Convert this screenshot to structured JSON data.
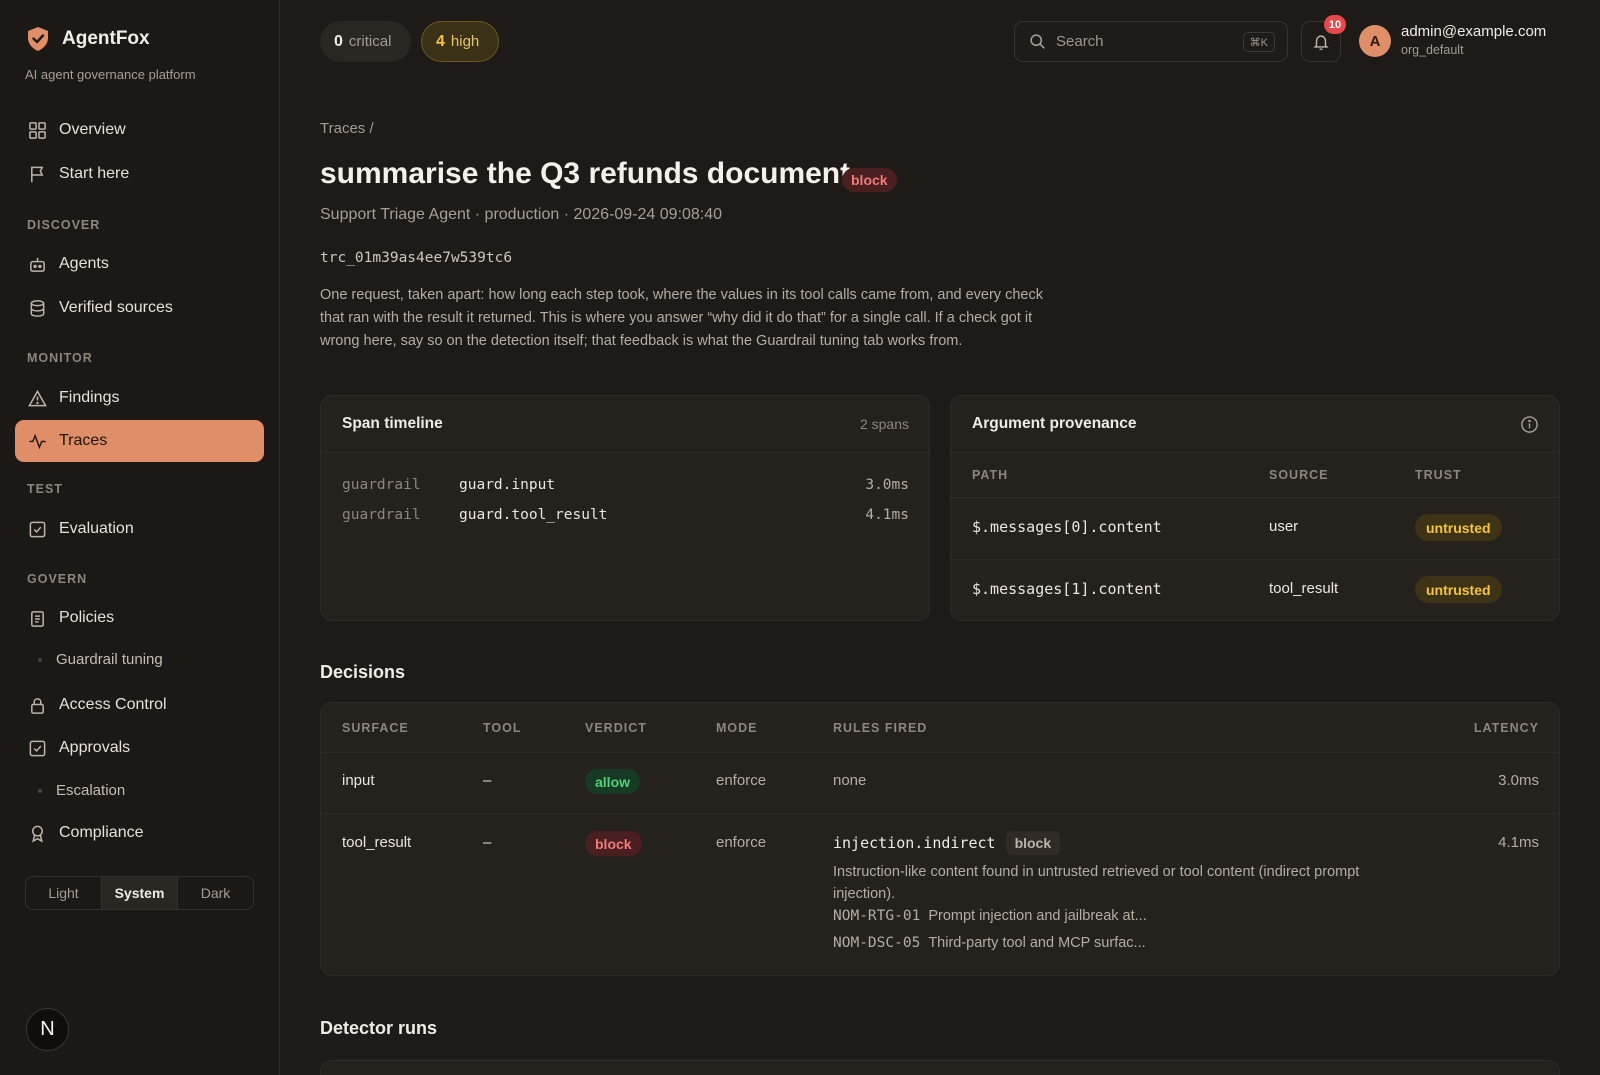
{
  "brand": {
    "name": "AgentFox",
    "tagline": "AI agent governance platform"
  },
  "nav": {
    "overview": "Overview",
    "start_here": "Start here",
    "discover_label": "DISCOVER",
    "agents": "Agents",
    "verified_sources": "Verified sources",
    "monitor_label": "MONITOR",
    "findings": "Findings",
    "traces": "Traces",
    "test_label": "TEST",
    "evaluation": "Evaluation",
    "govern_label": "GOVERN",
    "policies": "Policies",
    "guardrail_tuning": "Guardrail tuning",
    "access_control": "Access Control",
    "approvals": "Approvals",
    "escalation": "Escalation",
    "compliance": "Compliance"
  },
  "theme": {
    "light": "Light",
    "system": "System",
    "dark": "Dark",
    "selected": "System"
  },
  "footer_badge": "N",
  "header": {
    "critical_count": "0",
    "critical_label": "critical",
    "high_count": "4",
    "high_label": "high",
    "search_placeholder": "Search",
    "search_shortcut": "⌘K",
    "notifications": "10",
    "avatar_initial": "A",
    "user_email": "admin@example.com",
    "user_org": "org_default"
  },
  "trace": {
    "breadcrumb": "Traces  /",
    "title": "summarise the Q3 refunds document",
    "verdict": "block",
    "subline": "Support Triage Agent · production · 2026-09-24 09:08:40",
    "id": "trc_01m39as4ee7w539tc6",
    "description": "One request, taken apart: how long each step took, where the values in its tool calls came from, and every check that ran with the result it returned. This is where you answer “why did it do that” for a single call. If a check got it wrong here, say so on the detection itself; that feedback is what the Guardrail tuning tab works from."
  },
  "span_timeline": {
    "title": "Span timeline",
    "count": "2 spans",
    "spans": [
      {
        "kind": "guardrail",
        "name": "guard.input",
        "duration": "3.0ms"
      },
      {
        "kind": "guardrail",
        "name": "guard.tool_result",
        "duration": "4.1ms"
      }
    ]
  },
  "provenance": {
    "title": "Argument provenance",
    "headers": {
      "path": "PATH",
      "source": "SOURCE",
      "trust": "TRUST"
    },
    "rows": [
      {
        "path": "$.messages[0].content",
        "source": "user",
        "trust": "untrusted"
      },
      {
        "path": "$.messages[1].content",
        "source": "tool_result",
        "trust": "untrusted"
      }
    ]
  },
  "decisions": {
    "title": "Decisions",
    "headers": {
      "surface": "SURFACE",
      "tool": "TOOL",
      "verdict": "VERDICT",
      "mode": "MODE",
      "rules": "RULES FIRED",
      "latency": "LATENCY"
    },
    "rows": [
      {
        "surface": "input",
        "tool": "–",
        "verdict": "allow",
        "mode": "enforce",
        "rules": "none",
        "latency": "3.0ms"
      },
      {
        "surface": "tool_result",
        "tool": "–",
        "verdict": "block",
        "mode": "enforce",
        "latency": "4.1ms",
        "rule_name": "injection.indirect",
        "rule_action": "block",
        "rule_desc": "Instruction-like content found in untrusted retrieved or tool content (indirect prompt injection).",
        "controls": [
          {
            "id": "NOM-RTG-01",
            "text": "Prompt injection and jailbreak at..."
          },
          {
            "id": "NOM-DSC-05",
            "text": "Third-party tool and MCP surfac..."
          }
        ]
      }
    ]
  },
  "detector_runs": {
    "title": "Detector runs"
  },
  "colors": {
    "accent": "#e08e67",
    "block": "#f07a7a",
    "allow": "#4fd17a",
    "warning": "#f4c542"
  }
}
